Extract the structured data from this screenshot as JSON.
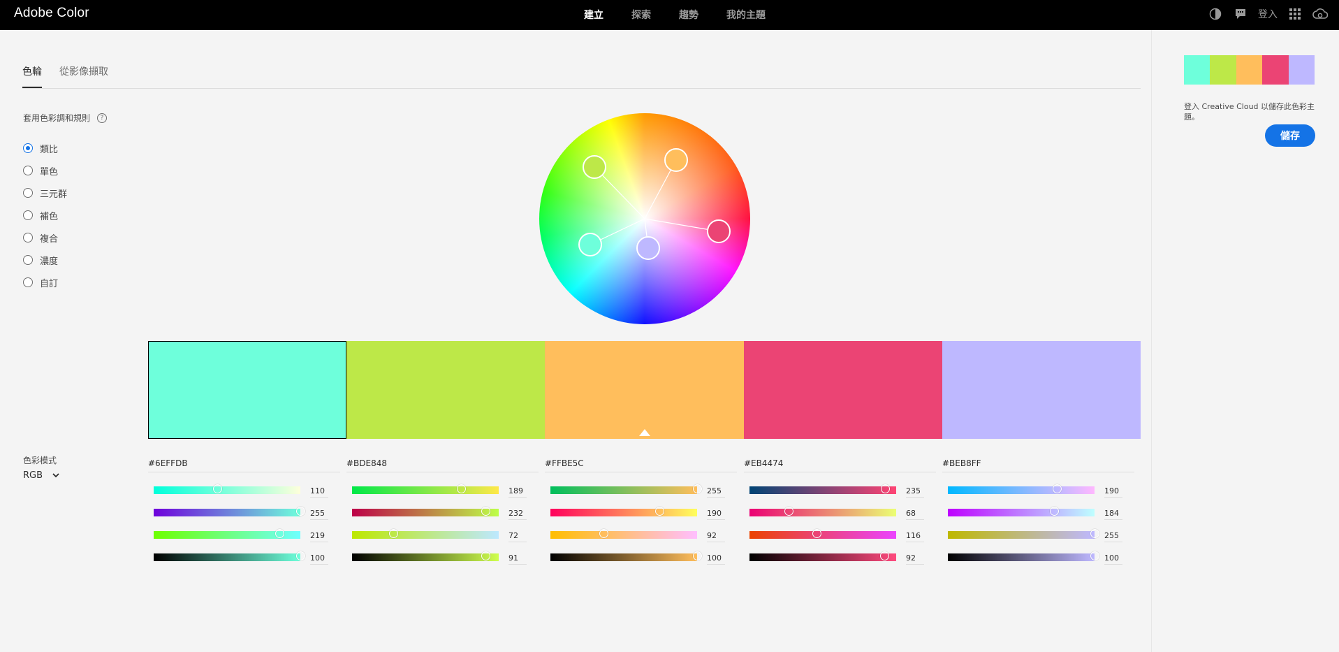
{
  "app": {
    "title": "Adobe Color"
  },
  "nav": {
    "items": [
      "建立",
      "探索",
      "趨勢",
      "我的主題"
    ],
    "active": 0
  },
  "topRight": {
    "signin": "登入",
    "icons": [
      "accessibility-icon",
      "feedback-icon",
      "apps-grid-icon",
      "creative-cloud-icon"
    ]
  },
  "tabs": [
    {
      "label": "色輪",
      "active": true
    },
    {
      "label": "從影像擷取",
      "active": false
    }
  ],
  "harmony": {
    "title": "套用色彩調和規則",
    "help": "?",
    "rules": [
      "類比",
      "單色",
      "三元群",
      "補色",
      "複合",
      "濃度",
      "自訂"
    ],
    "selected": 0
  },
  "colorMode": {
    "label": "色彩模式",
    "value": "RGB"
  },
  "swatches": [
    {
      "hex": "#6EFFDB",
      "color": "#6EFFDB",
      "values": [
        110,
        255,
        219,
        100
      ]
    },
    {
      "hex": "#BDE848",
      "color": "#BDE848",
      "values": [
        189,
        232,
        72,
        91
      ]
    },
    {
      "hex": "#FFBE5C",
      "color": "#FFBE5C",
      "values": [
        255,
        190,
        92,
        100
      ]
    },
    {
      "hex": "#EB4474",
      "color": "#EB4474",
      "values": [
        235,
        68,
        116,
        92
      ]
    },
    {
      "hex": "#BEB8FF",
      "color": "#BEB8FF",
      "values": [
        190,
        184,
        255,
        100
      ]
    }
  ],
  "selectedSwatch": 0,
  "baseSwatch": 2,
  "rightPanel": {
    "message": "登入 Creative Cloud 以儲存此色彩主題。",
    "save": "儲存"
  }
}
